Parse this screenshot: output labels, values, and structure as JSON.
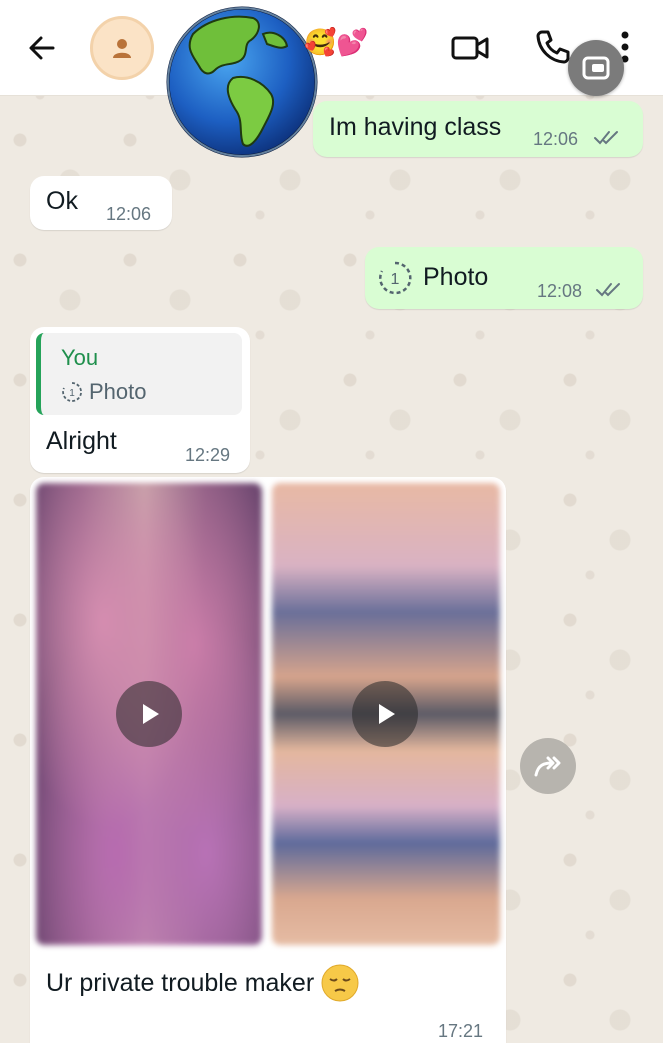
{
  "header": {
    "back_icon": "arrow-left-icon",
    "avatar_icon": "person-icon",
    "profile_decoration": "globe-sticker",
    "emoji_strip": "🥰💕",
    "video_icon": "video-camera-icon",
    "call_icon": "phone-icon",
    "menu_icon": "more-vertical-icon",
    "overlay_icon": "picture-in-picture-icon"
  },
  "messages": [
    {
      "direction": "out",
      "text": "Im having class",
      "time": "12:06",
      "status": "read"
    },
    {
      "direction": "in",
      "text": "Ok",
      "time": "12:06"
    },
    {
      "direction": "out",
      "text": "Photo",
      "time": "12:08",
      "status": "read",
      "view_once": true,
      "view_once_label": "1"
    },
    {
      "direction": "in",
      "reply_to": {
        "author": "You",
        "body": "Photo",
        "view_once_label": "1"
      },
      "text": "Alright",
      "time": "12:29"
    },
    {
      "direction": "in",
      "media": [
        "video",
        "video"
      ],
      "caption": "Ur private trouble maker",
      "caption_emoji": "😔",
      "time": "17:21"
    }
  ],
  "colors": {
    "outgoing_bubble": "#d9fdd3",
    "incoming_bubble": "#ffffff",
    "wallpaper": "#efeae2",
    "accent_green": "#25a35a",
    "read_ticks": "#667781"
  }
}
